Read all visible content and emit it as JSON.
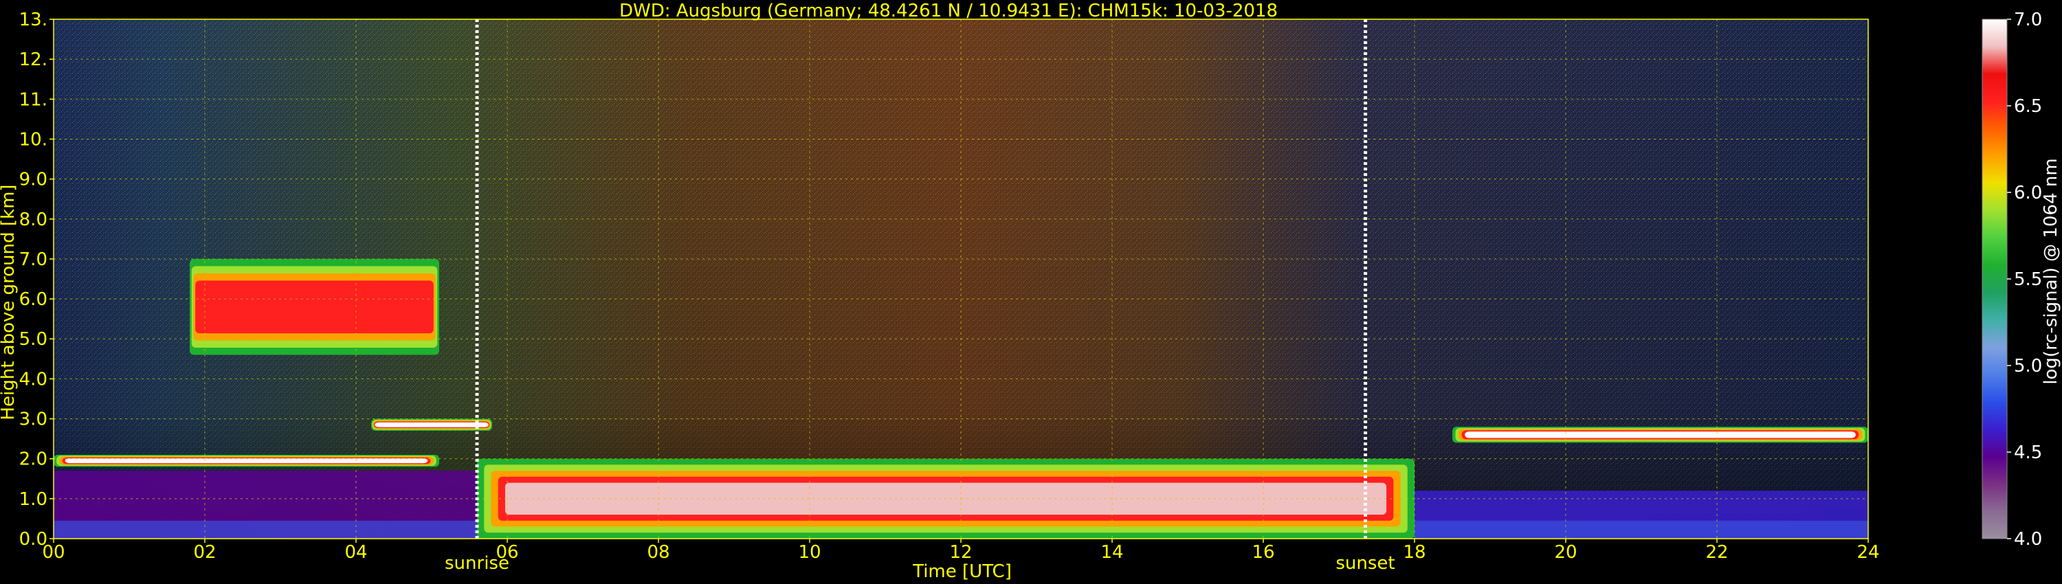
{
  "chart_data": {
    "type": "heatmap",
    "title": "DWD: Augsburg (Germany; 48.4261 N / 10.9431 E):    CHM15k: 10-03-2018",
    "xlabel": "Time [UTC]",
    "ylabel": "Height above ground [km]",
    "colorbar_label": "log(rc-signal) @ 1064 nm",
    "x_range": [
      0,
      24
    ],
    "y_range": [
      0.0,
      13.0
    ],
    "colorbar_range": [
      4.0,
      7.0
    ],
    "x_ticks": [
      "00",
      "02",
      "04",
      "06",
      "08",
      "10",
      "12",
      "14",
      "16",
      "18",
      "20",
      "22",
      "24"
    ],
    "y_ticks": [
      "0.0",
      "1.0",
      "2.0",
      "3.0",
      "4.0",
      "5.0",
      "6.0",
      "7.0",
      "8.0",
      "9.0",
      "10.",
      "11.",
      "12.",
      "13."
    ],
    "colorbar_ticks": [
      "4.0",
      "4.5",
      "5.0",
      "5.5",
      "6.0",
      "6.5",
      "7.0"
    ],
    "grid": true,
    "markers": [
      {
        "label": "sunrise",
        "time": 5.6
      },
      {
        "label": "sunset",
        "time": 17.35
      }
    ],
    "annotations": {
      "sunrise": "sunrise",
      "sunset": "sunset"
    },
    "colormap": [
      "#9a8fa0",
      "#8a6b93",
      "#7a2f84",
      "#5a0090",
      "#3a1fd0",
      "#2a4fe8",
      "#4f7fe8",
      "#7fa0e0",
      "#40b0a8",
      "#20a060",
      "#20b030",
      "#50d040",
      "#a0e030",
      "#f0e000",
      "#ffa000",
      "#ff6000",
      "#ff2020",
      "#ee1010",
      "#f0c0c0",
      "#ffffff"
    ],
    "cloud_layers": [
      {
        "t_start": 0.0,
        "t_end": 5.1,
        "base_km": 1.8,
        "top_km": 2.1,
        "intensity": 7.0
      },
      {
        "t_start": 1.8,
        "t_end": 5.1,
        "base_km": 4.6,
        "top_km": 7.0,
        "intensity": 6.6
      },
      {
        "t_start": 4.2,
        "t_end": 5.8,
        "base_km": 2.7,
        "top_km": 3.0,
        "intensity": 7.0
      },
      {
        "t_start": 5.6,
        "t_end": 18.0,
        "base_km": 0.0,
        "top_km": 2.0,
        "intensity": 6.8
      },
      {
        "t_start": 18.5,
        "t_end": 24.0,
        "base_km": 2.4,
        "top_km": 2.8,
        "intensity": 7.0
      }
    ],
    "boundary_layer": [
      {
        "t_start": 0.0,
        "t_end": 5.6,
        "top_km": 1.7,
        "intensity": 4.5
      },
      {
        "t_start": 18.0,
        "t_end": 24.0,
        "top_km": 1.2,
        "intensity": 4.6
      }
    ]
  }
}
